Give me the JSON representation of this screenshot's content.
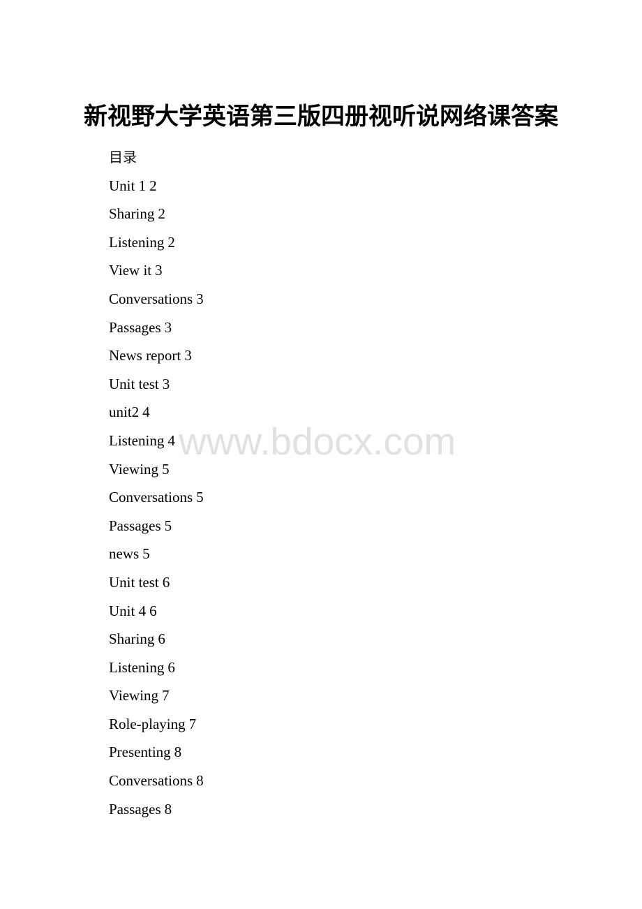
{
  "document": {
    "title": "新视野大学英语第三版四册视听说网络课答案",
    "toc_heading": "目录",
    "toc": [
      {
        "label": "Unit 1",
        "page": "2"
      },
      {
        "label": "Sharing",
        "page": "2"
      },
      {
        "label": "Listening",
        "page": "2"
      },
      {
        "label": "View it",
        "page": "3"
      },
      {
        "label": "Conversations",
        "page": "3"
      },
      {
        "label": "Passages",
        "page": "3"
      },
      {
        "label": "News report",
        "page": "3"
      },
      {
        "label": "Unit test",
        "page": "3"
      },
      {
        "label": "unit2",
        "page": "4"
      },
      {
        "label": "Listening",
        "page": "4"
      },
      {
        "label": "Viewing",
        "page": "5"
      },
      {
        "label": "Conversations",
        "page": "5"
      },
      {
        "label": "Passages",
        "page": "5"
      },
      {
        "label": "news",
        "page": "5"
      },
      {
        "label": "Unit test",
        "page": "6"
      },
      {
        "label": "Unit 4",
        "page": "6"
      },
      {
        "label": "Sharing",
        "page": "6"
      },
      {
        "label": "Listening",
        "page": "6"
      },
      {
        "label": "Viewing",
        "page": "7"
      },
      {
        "label": "Role-playing",
        "page": "7"
      },
      {
        "label": "Presenting",
        "page": "8"
      },
      {
        "label": "Conversations",
        "page": "8"
      },
      {
        "label": "Passages",
        "page": "8"
      }
    ],
    "watermark": "www.bdocx.com"
  }
}
